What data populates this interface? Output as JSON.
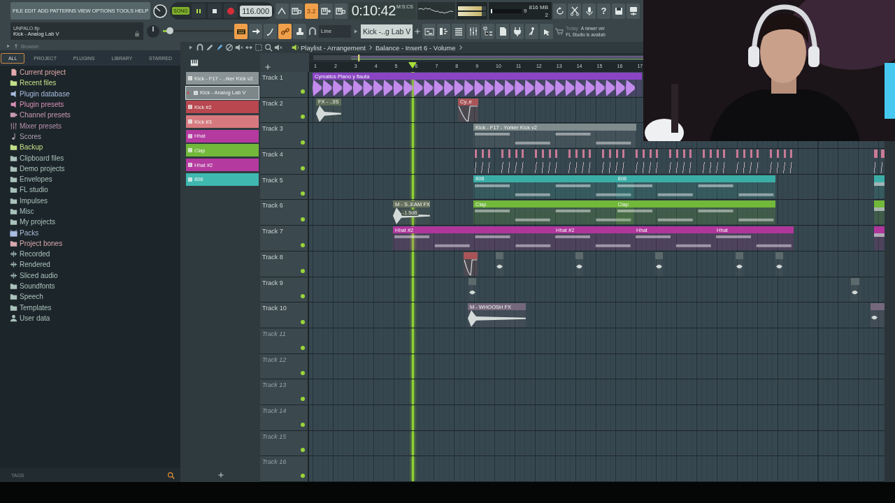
{
  "menu": [
    "FILE",
    "EDIT",
    "ADD",
    "PATTERNS",
    "VIEW",
    "OPTIONS",
    "TOOLS",
    "HELP"
  ],
  "hint": {
    "file": "UNPALO.flp",
    "channel": "Kick - Analog Lab V"
  },
  "transport": {
    "mode": "SONG",
    "playing": true,
    "recording": false,
    "tempo": "116.000"
  },
  "countdown": {
    "label": "3.2",
    "on": true
  },
  "clock": {
    "time": "0:10:42",
    "unit": "M:S:CS"
  },
  "master_meters": [
    {
      "level": 0.86
    },
    {
      "level": 0.86
    }
  ],
  "monitor": {
    "cpu": "9",
    "memory": "816 MB",
    "polyphony": "2",
    "level": 0.05
  },
  "help_glyph": "?",
  "pitch": {
    "level": 0.1
  },
  "toggles": [
    {
      "kind": "typing-keyboard",
      "on": true
    },
    {
      "kind": "arrow",
      "on": false
    },
    {
      "kind": "curve",
      "on": false
    },
    {
      "kind": "link",
      "on": true
    }
  ],
  "snap": "Line",
  "pattern": "Kick -..g Lab V",
  "news": {
    "date": "Today",
    "line1": "A newer ver",
    "line2": "FL Studio is availab"
  },
  "browser": {
    "title": "Browser",
    "tabs": [
      {
        "label": "ALL",
        "selected": true
      },
      {
        "label": "PROJECT",
        "selected": false
      },
      {
        "label": "PLUGINS",
        "selected": false
      },
      {
        "label": "LIBRARY",
        "selected": false
      },
      {
        "label": "STARRED",
        "selected": false
      }
    ],
    "items": [
      {
        "label": "Current project",
        "kind": "document",
        "color": "#e0a9ab"
      },
      {
        "label": "Recent files",
        "kind": "folder",
        "color": "#c3e08a"
      },
      {
        "label": "Plugin database",
        "kind": "plug",
        "color": "#a9bde0"
      },
      {
        "label": "Plugin presets",
        "kind": "plug",
        "color": "#d890b6"
      },
      {
        "label": "Channel presets",
        "kind": "channel",
        "color": "#c99ab0"
      },
      {
        "label": "Mixer presets",
        "kind": "faders",
        "color": "#b993b0"
      },
      {
        "label": "Scores",
        "kind": "note",
        "color": "#b0a0b5"
      },
      {
        "label": "Backup",
        "kind": "folder",
        "color": "#c3e08a"
      },
      {
        "label": "Clipboard files",
        "kind": "folder",
        "color": "#a9c2bb"
      },
      {
        "label": "Demo projects",
        "kind": "folder",
        "color": "#a9c2bb"
      },
      {
        "label": "Envelopes",
        "kind": "folder",
        "color": "#a9c2bb"
      },
      {
        "label": "FL studio",
        "kind": "folder",
        "color": "#a9c2bb"
      },
      {
        "label": "Impulses",
        "kind": "folder",
        "color": "#a9c2bb"
      },
      {
        "label": "Misc",
        "kind": "folder",
        "color": "#a9c2bb"
      },
      {
        "label": "My projects",
        "kind": "folder",
        "color": "#a9c2bb"
      },
      {
        "label": "Packs",
        "kind": "box",
        "color": "#a9bde0"
      },
      {
        "label": "Project bones",
        "kind": "folder",
        "color": "#d8a9b0"
      },
      {
        "label": "Recorded",
        "kind": "wave",
        "color": "#a9c2bb"
      },
      {
        "label": "Rendered",
        "kind": "wave",
        "color": "#a9c2bb"
      },
      {
        "label": "Sliced audio",
        "kind": "wave",
        "color": "#a9c2bb"
      },
      {
        "label": "Soundfonts",
        "kind": "folder",
        "color": "#a9c2bb"
      },
      {
        "label": "Speech",
        "kind": "folder",
        "color": "#a9c2bb"
      },
      {
        "label": "Templates",
        "kind": "folder",
        "color": "#a9c2bb"
      },
      {
        "label": "User data",
        "kind": "person",
        "color": "#a9c2bb"
      }
    ],
    "tags": "TAGS"
  },
  "playlist": {
    "title": "Playlist - Arrangement",
    "target": "Balance - Insert 6 - Volume"
  },
  "channels": [
    {
      "label": "Kick - F17 - ..rker Kick v2",
      "color": "#8a9496",
      "selected": false
    },
    {
      "label": "Kick - Analog Lab V",
      "color": "#7d8789",
      "selected": true
    },
    {
      "label": "Kick #2",
      "color": "#b8474f",
      "selected": false
    },
    {
      "label": "Kick #3",
      "color": "#d77a7f",
      "selected": false
    },
    {
      "label": "Hhat",
      "color": "#b53aa0",
      "selected": false
    },
    {
      "label": "Clap",
      "color": "#72b83a",
      "selected": false
    },
    {
      "label": "Hhat #2",
      "color": "#b53aa0",
      "selected": false
    },
    {
      "label": "808",
      "color": "#3fb8b0",
      "selected": false
    }
  ],
  "ruler": [
    "1",
    "2",
    "3",
    "4",
    "5",
    "6",
    "7",
    "8",
    "9",
    "10",
    "11",
    "12",
    "13",
    "14",
    "15",
    "16",
    "17"
  ],
  "tracks": [
    {
      "label": "Track 1",
      "on": true,
      "clips": [
        {
          "label": "Cymatics Piano y flauta",
          "kind": "audio",
          "color": "#8a45c4"
        }
      ]
    },
    {
      "label": "Track 2",
      "on": true,
      "clips": [
        {
          "label": "FX - ..3S",
          "kind": "audio",
          "color": "#5f6e58"
        },
        {
          "label": "Cy..e",
          "kind": "automation",
          "color": "#a85458"
        }
      ]
    },
    {
      "label": "Track 3",
      "on": true,
      "clips": [
        {
          "label": "Kick - F17 - Yorker Kick v2",
          "kind": "pattern",
          "color": "#7f8b8c"
        }
      ]
    },
    {
      "label": "Track 4",
      "on": true,
      "clips": [
        {
          "kind": "notes",
          "color": "#c87a96"
        },
        {
          "kind": "notes",
          "color": "#c87a96"
        }
      ]
    },
    {
      "label": "Track 5",
      "on": true,
      "clips": [
        {
          "label": "808",
          "kind": "pattern",
          "color": "#3aaea6"
        },
        {
          "label": "808",
          "kind": "pattern",
          "color": "#3aaea6"
        },
        {
          "kind": "pattern",
          "color": "#3aaea6"
        }
      ]
    },
    {
      "label": "Track 6",
      "on": true,
      "clips": [
        {
          "label": "M - S..EAM FX",
          "kind": "audio",
          "color": "#66705c",
          "tip": "-1.5dB"
        },
        {
          "label": "Clap",
          "kind": "pattern",
          "color": "#72b83a"
        },
        {
          "label": "Clap",
          "kind": "pattern",
          "color": "#72b83a"
        },
        {
          "kind": "pattern",
          "color": "#72b83a"
        }
      ]
    },
    {
      "label": "Track 7",
      "on": true,
      "clips": [
        {
          "label": "Hhat #2",
          "kind": "pattern",
          "color": "#b0369c"
        },
        {
          "label": "Hhat #2",
          "kind": "pattern",
          "color": "#b0369c"
        },
        {
          "label": "Hhat",
          "kind": "pattern",
          "color": "#b0369c"
        },
        {
          "label": "Hhat",
          "kind": "pattern",
          "color": "#b0369c"
        },
        {
          "kind": "pattern",
          "color": "#b0369c"
        }
      ]
    },
    {
      "label": "Track 8",
      "on": true,
      "clips": [
        {
          "kind": "automation",
          "color": "#a85458"
        },
        {
          "kind": "audio",
          "color": "#5d6a6c"
        },
        {
          "kind": "audio",
          "color": "#5d6a6c"
        },
        {
          "kind": "audio",
          "color": "#5d6a6c"
        },
        {
          "kind": "audio",
          "color": "#5d6a6c"
        },
        {
          "kind": "audio",
          "color": "#5d6a6c"
        }
      ]
    },
    {
      "label": "Track 9",
      "on": true,
      "clips": [
        {
          "kind": "audio",
          "color": "#5d6a6c"
        },
        {
          "kind": "audio",
          "color": "#5d6a6c"
        }
      ]
    },
    {
      "label": "Track 10",
      "on": true,
      "clips": [
        {
          "label": "M - WHOOSH FX",
          "kind": "audio",
          "color": "#75687c"
        },
        {
          "kind": "audio",
          "color": "#75687c"
        }
      ]
    },
    {
      "label": "Track 11",
      "on": true
    },
    {
      "label": "Track 12",
      "on": true
    },
    {
      "label": "Track 13",
      "on": true
    },
    {
      "label": "Track 14",
      "on": true
    },
    {
      "label": "Track 15",
      "on": true
    },
    {
      "label": "Track 16",
      "on": true
    }
  ]
}
